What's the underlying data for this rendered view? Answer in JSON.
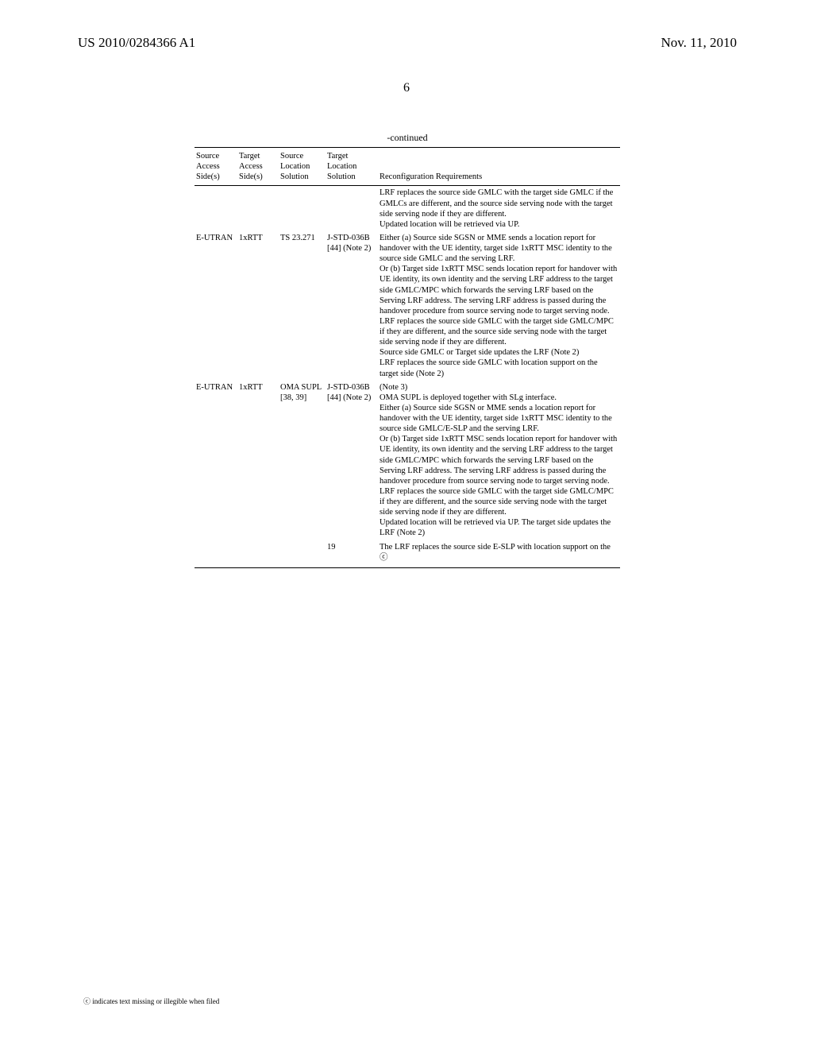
{
  "header": {
    "pub_number": "US 2010/0284366 A1",
    "pub_date": "Nov. 11, 2010"
  },
  "page_number": "6",
  "table": {
    "continued_label": "-continued",
    "headers": [
      "Source Access Side(s)",
      "Target Access Side(s)",
      "Source Location Solution",
      "Target Location Solution",
      "Reconfiguration Requirements"
    ],
    "rows": [
      {
        "source_access": "",
        "target_access": "",
        "source_loc": "",
        "target_loc": "",
        "req": "LRF replaces the source side GMLC with the target side GMLC if the GMLCs are different, and the source side serving node with the target side serving node if they are different.\nUpdated location will be retrieved via UP."
      },
      {
        "source_access": "E-UTRAN",
        "target_access": "1xRTT",
        "source_loc": "TS 23.271",
        "target_loc": "J-STD-036B [44] (Note 2)",
        "req": "Either (a) Source side SGSN or MME sends a location report for handover with the UE identity, target side 1xRTT MSC identity to the source side GMLC and the serving LRF.\nOr (b) Target side 1xRTT MSC sends location report for handover with UE identity, its own identity and the serving LRF address to the target side GMLC/MPC which forwards the serving LRF based on the Serving LRF address. The serving LRF address is passed during the handover procedure from source serving node to target serving node.\nLRF replaces the source side GMLC with the target side GMLC/MPC if they are different, and the source side serving node with the target side serving node if they are different.\nSource side GMLC or Target side updates the LRF (Note 2)\nLRF replaces the source side GMLC with location support on the target side (Note 2)"
      },
      {
        "source_access": "E-UTRAN",
        "target_access": "1xRTT",
        "source_loc": "OMA SUPL [38, 39]",
        "target_loc": "J-STD-036B [44] (Note 2)",
        "req": "(Note 3)\nOMA SUPL is deployed together with SLg interface.\nEither (a) Source side SGSN or MME sends a location report for handover with the UE identity, target side 1xRTT MSC identity to the source side GMLC/E-SLP and the serving LRF.\nOr (b) Target side 1xRTT MSC sends location report for handover with UE identity, its own identity and the serving LRF address to the target side GMLC/MPC which forwards the serving LRF based on the Serving LRF address. The serving LRF address is passed during the handover procedure from source serving node to target serving node.\nLRF replaces the source side GMLC with the target side GMLC/MPC if they are different, and the source side serving node with the target side serving node if they are different.\nUpdated location will be retrieved via UP. The target side updates the LRF (Note 2)"
      },
      {
        "source_access": "",
        "target_access": "",
        "source_loc": "",
        "target_loc": "19",
        "req": "The LRF replaces the source side E-SLP with location support on the ⓒ"
      }
    ]
  },
  "footnote": "ⓒ indicates text missing or illegible when filed",
  "chart_data": {
    "type": "table",
    "title": "-continued",
    "columns": [
      "Source Access Side(s)",
      "Target Access Side(s)",
      "Source Location Solution",
      "Target Location Solution",
      "Reconfiguration Requirements"
    ],
    "rows": [
      [
        "",
        "",
        "",
        "",
        "LRF replaces the source side GMLC with the target side GMLC if the GMLCs are different, and the source side serving node with the target side serving node if they are different. Updated location will be retrieved via UP."
      ],
      [
        "E-UTRAN",
        "1xRTT",
        "TS 23.271",
        "J-STD-036B [44] (Note 2)",
        "Either (a) Source side SGSN or MME sends a location report for handover with the UE identity, target side 1xRTT MSC identity to the source side GMLC and the serving LRF. Or (b) Target side 1xRTT MSC sends location report for handover with UE identity, its own identity and the serving LRF address to the target side GMLC/MPC which forwards the serving LRF based on the Serving LRF address. The serving LRF address is passed during the handover procedure from source serving node to target serving node. LRF replaces the source side GMLC with the target side GMLC/MPC if they are different, and the source side serving node with the target side serving node if they are different. Source side GMLC or Target side updates the LRF (Note 2) LRF replaces the source side GMLC with location support on the target side (Note 2)"
      ],
      [
        "E-UTRAN",
        "1xRTT",
        "OMA SUPL [38, 39]",
        "J-STD-036B [44] (Note 2)",
        "(Note 3) OMA SUPL is deployed together with SLg interface. Either (a) Source side SGSN or MME sends a location report for handover with the UE identity, target side 1xRTT MSC identity to the source side GMLC/E-SLP and the serving LRF. Or (b) Target side 1xRTT MSC sends location report for handover with UE identity, its own identity and the serving LRF address to the target side GMLC/MPC which forwards the serving LRF based on the Serving LRF address. The serving LRF address is passed during the handover procedure from source serving node to target serving node. LRF replaces the source side GMLC with the target side GMLC/MPC if they are different, and the source side serving node with the target side serving node if they are different. Updated location will be retrieved via UP. The target side updates the LRF (Note 2)"
      ],
      [
        "",
        "",
        "",
        "19",
        "The LRF replaces the source side E-SLP with location support on the [illegible]"
      ]
    ]
  }
}
